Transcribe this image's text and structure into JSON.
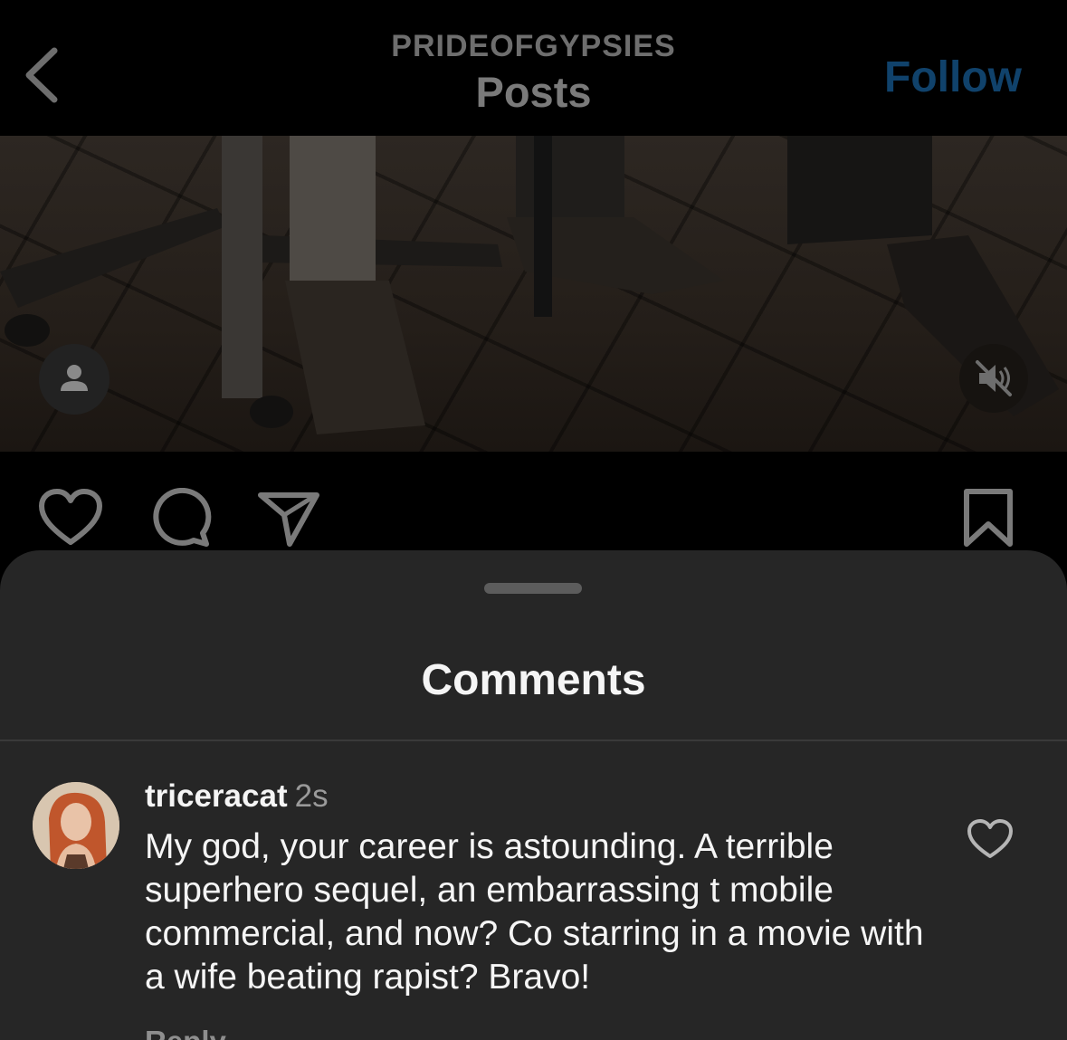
{
  "header": {
    "account": "PRIDEOFGYPSIES",
    "title": "Posts",
    "follow_label": "Follow"
  },
  "media": {
    "user_tag_icon": "person-icon",
    "mute_icon": "speaker-muted-icon"
  },
  "actions": {
    "like_icon": "heart-icon",
    "comment_icon": "comment-bubble-icon",
    "share_icon": "paper-plane-icon",
    "save_icon": "bookmark-icon"
  },
  "comments_sheet": {
    "title": "Comments",
    "comments": [
      {
        "username": "triceracat",
        "time": "2s",
        "text": "My god, your career is astounding. A terrible superhero sequel, an embarrassing t mobile commercial, and now? Co starring in a movie with a wife beating rapist? Bravo!",
        "reply_label": "Reply"
      }
    ]
  },
  "colors": {
    "follow": "#10426b",
    "sheet_bg": "#262626",
    "text": "#f5f5f5",
    "muted": "#9a9a9a"
  }
}
